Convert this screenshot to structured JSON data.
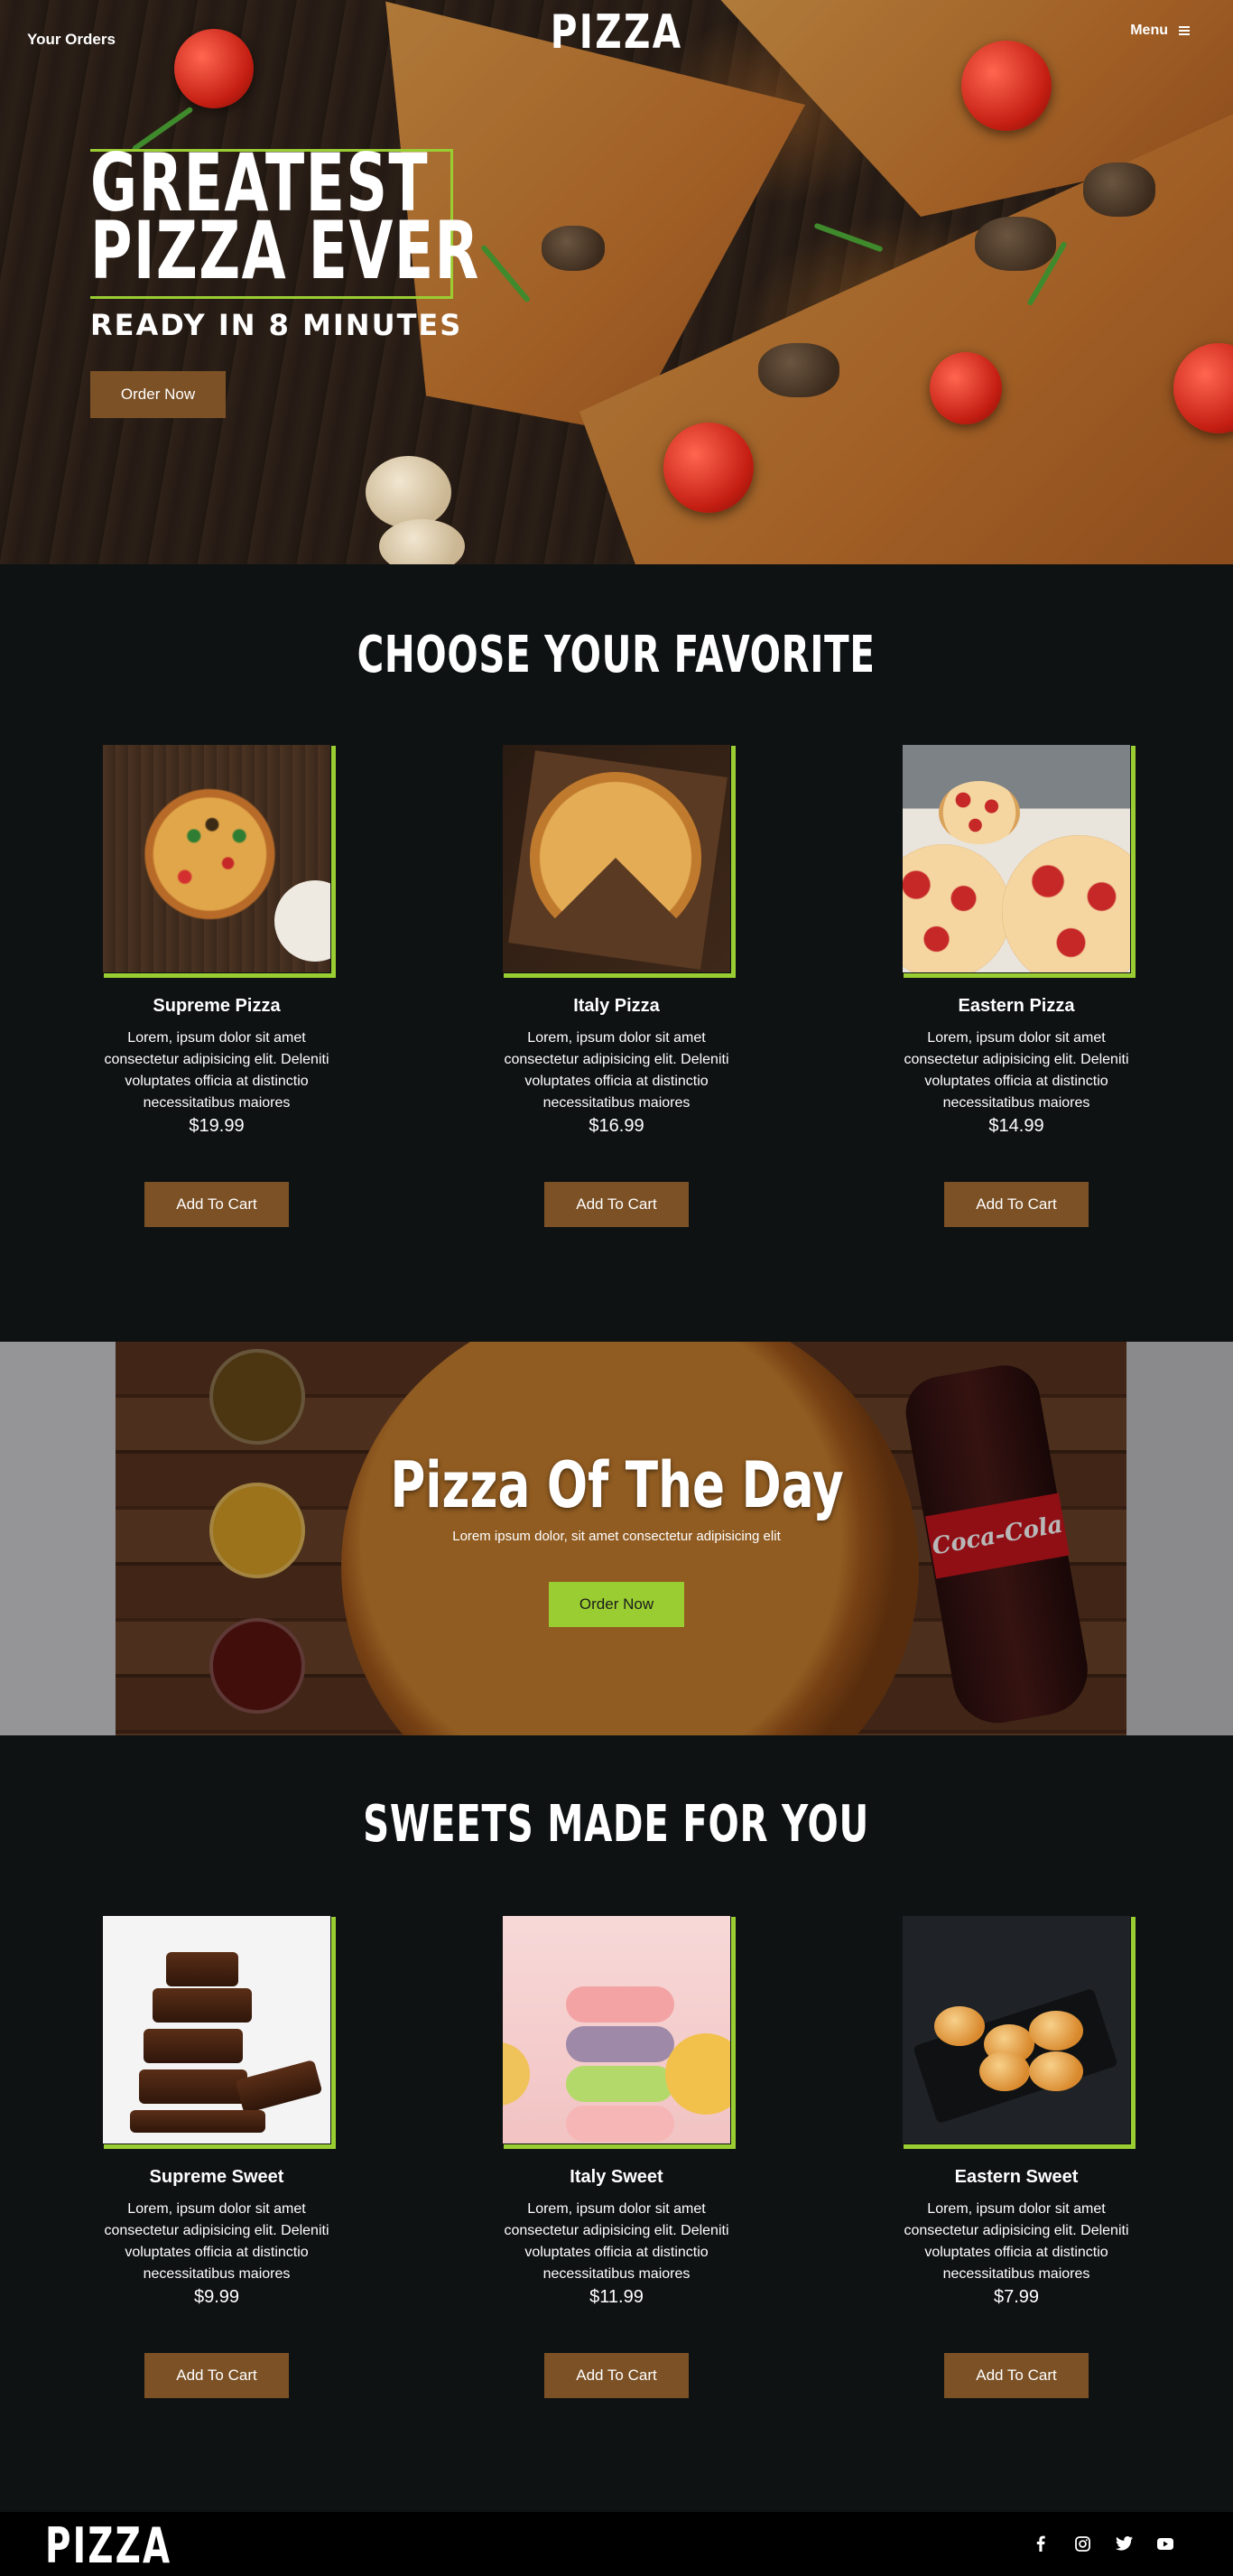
{
  "header": {
    "left_link": "Your Orders",
    "brand": "PIZZA",
    "menu_label": "Menu",
    "menu_icon": "burger-menu-icon"
  },
  "hero": {
    "title_line1": "GREATEST",
    "title_line2": "PIZZA EVER",
    "subtitle": "READY IN 8 MINUTES",
    "cta": "Order Now"
  },
  "favorites": {
    "title": "CHOOSE YOUR FAVORITE",
    "items": [
      {
        "name": "Supreme Pizza",
        "desc": "Lorem, ipsum dolor sit amet consectetur adipisicing elit. Deleniti voluptates officia at distinctio necessitatibus maiores",
        "price": "$19.99",
        "button": "Add To Cart"
      },
      {
        "name": "Italy Pizza",
        "desc": "Lorem, ipsum dolor sit amet consectetur adipisicing elit. Deleniti voluptates officia at distinctio necessitatibus maiores",
        "price": "$16.99",
        "button": "Add To Cart"
      },
      {
        "name": "Eastern Pizza",
        "desc": "Lorem, ipsum dolor sit amet consectetur adipisicing elit. Deleniti voluptates officia at distinctio necessitatibus maiores",
        "price": "$14.99",
        "button": "Add To Cart"
      }
    ]
  },
  "pizza_of_the_day": {
    "title": "Pizza Of The Day",
    "subtitle": "Lorem ipsum dolor, sit amet consectetur adipisicing elit",
    "cta": "Order Now",
    "bottle_label": "Coca-Cola"
  },
  "sweets": {
    "title": "SWEETS MADE FOR YOU",
    "items": [
      {
        "name": "Supreme Sweet",
        "desc": "Lorem, ipsum dolor sit amet consectetur adipisicing elit. Deleniti voluptates officia at distinctio necessitatibus maiores",
        "price": "$9.99",
        "button": "Add To Cart"
      },
      {
        "name": "Italy Sweet",
        "desc": "Lorem, ipsum dolor sit amet consectetur adipisicing elit. Deleniti voluptates officia at distinctio necessitatibus maiores",
        "price": "$11.99",
        "button": "Add To Cart"
      },
      {
        "name": "Eastern Sweet",
        "desc": "Lorem, ipsum dolor sit amet consectetur adipisicing elit. Deleniti voluptates officia at distinctio necessitatibus maiores",
        "price": "$7.99",
        "button": "Add To Cart"
      }
    ]
  },
  "footer": {
    "brand": "PIZZA",
    "social_icons": [
      "facebook-icon",
      "instagram-icon",
      "twitter-icon",
      "youtube-icon"
    ]
  },
  "colors": {
    "accent_green": "#9acd32",
    "button_brown": "#7c5125",
    "page_background": "#0e1213",
    "footer_background": "#000000"
  }
}
